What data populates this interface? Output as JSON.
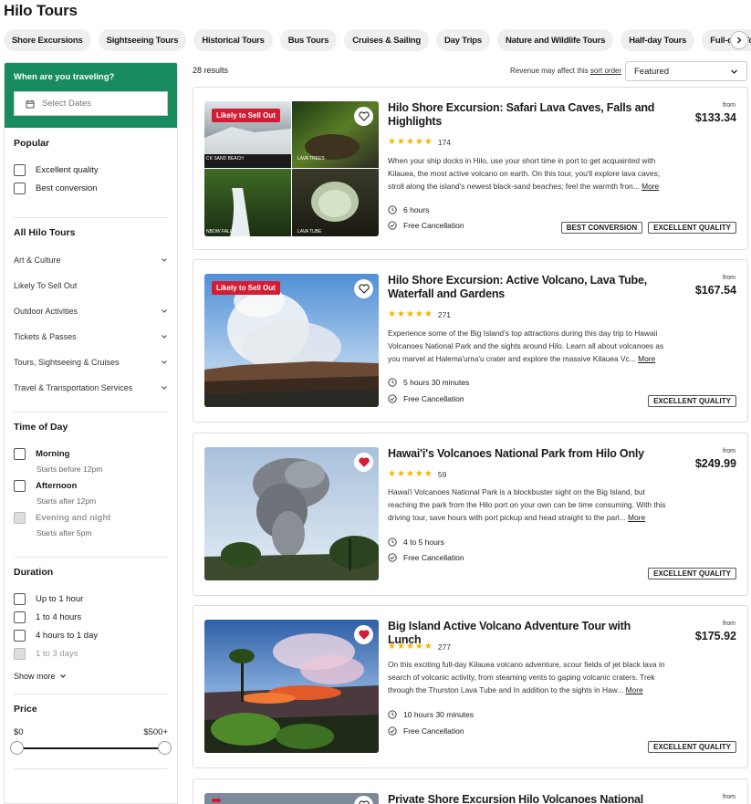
{
  "page_title": "Hilo Tours",
  "categories": [
    "Shore Excursions",
    "Sightseeing Tours",
    "Historical Tours",
    "Bus Tours",
    "Cruises & Sailing",
    "Day Trips",
    "Nature and Wildlife Tours",
    "Half-day Tours",
    "Full-day Tours"
  ],
  "sidebar": {
    "date_question": "When are you traveling?",
    "date_placeholder": "Select Dates",
    "popular_title": "Popular",
    "popular": [
      "Excellent quality",
      "Best conversion"
    ],
    "all_title": "All Hilo Tours",
    "all": [
      "Art & Culture",
      "Likely To Sell Out",
      "Outdoor Activities",
      "Tickets & Passes",
      "Tours, Sightseeing & Cruises",
      "Travel & Transportation Services"
    ],
    "time_title": "Time of Day",
    "time": [
      {
        "label": "Morning",
        "sub": "Starts before 12pm"
      },
      {
        "label": "Afternoon",
        "sub": "Starts after 12pm"
      },
      {
        "label": "Evening and night",
        "sub": "Starts after 5pm"
      }
    ],
    "duration_title": "Duration",
    "duration": [
      "Up to 1 hour",
      "1 to 4 hours",
      "4 hours to 1 day",
      "1 to 3 days"
    ],
    "show_more": "Show more",
    "price_title": "Price",
    "price_min": "$0",
    "price_max": "$500+"
  },
  "results": {
    "count": "28 results",
    "sort_note": "Revenue may affect this",
    "sort_link": "sort order",
    "sort_value": "Featured"
  },
  "cards": [
    {
      "title": "Hilo Shore Excursion: Safari Lava Caves, Falls and Highlights",
      "badge": "Likely to Sell Out",
      "rating": "174",
      "desc": "When your ship docks in Hilo, use your short time in port to get acquainted with Kilauea, the most active volcano on earth. On this tour, you'll explore lava caves; stroll along the island's newest black-sand beaches; feel the warmth fron...",
      "more": "More",
      "duration": "6 hours",
      "cancel": "Free Cancellation",
      "from": "from",
      "price": "$133.34",
      "tags": [
        "BEST CONVERSION",
        "EXCELLENT QUALITY"
      ],
      "collage": [
        "CK SAND BEACH",
        "LAVA TREES",
        "NBOW FALLS",
        "LAVA TUBE"
      ]
    },
    {
      "title": "Hilo Shore Excursion: Active Volcano, Lava Tube, Waterfall and Gardens",
      "badge": "Likely to Sell Out",
      "rating": "271",
      "desc": "Experience some of the Big Island's top attractions during this day trip to Hawaii Volcanoes National Park and the sights around Hilo. Learn all about volcanoes as you marvel at Halema'uma'u crater and explore the massive Kilauea Vc...",
      "more": "More",
      "duration": "5 hours 30 minutes",
      "cancel": "Free Cancellation",
      "from": "from",
      "price": "$167.54",
      "tags": [
        "EXCELLENT QUALITY"
      ]
    },
    {
      "title": "Hawai'i's Volcanoes National Park from Hilo Only",
      "rating": "59",
      "desc": "Hawai'i Volcanoes National Park is a blockbuster sight on the Big Island, but reaching the park from the Hilo port on your own can be time consuming. With this driving tour, save hours with port pickup and head straight to the parl...",
      "more": "More",
      "duration": "4 to 5 hours",
      "cancel": "Free Cancellation",
      "from": "from",
      "price": "$249.99",
      "tags": [
        "EXCELLENT QUALITY"
      ]
    },
    {
      "title": "Big Island Active Volcano Adventure Tour with Lunch",
      "rating": "277",
      "desc": "On this exciting full-day Kilauea volcano adventure, scour fields of jet black lava in search of volcanic activity, from steaming vents to gaping volcanic craters. Trek through the Thurston Lava Tube and In addition to the sights in Haw...",
      "more": "More",
      "duration": "10 hours 30 minutes",
      "cancel": "Free Cancellation",
      "from": "from",
      "price": "$175.92",
      "tags": [
        "EXCELLENT QUALITY"
      ]
    },
    {
      "title": "Private Shore Excursion Hilo Volcanoes National Park",
      "from": "from"
    }
  ],
  "colors": {
    "green": "#188c5f",
    "red": "#d31d34",
    "star": "#f5b500"
  }
}
